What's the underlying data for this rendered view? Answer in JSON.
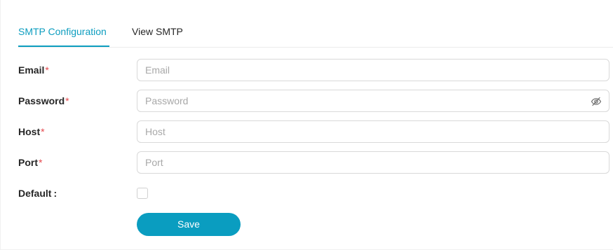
{
  "tabs": {
    "items": [
      {
        "label": "SMTP Configuration",
        "active": true
      },
      {
        "label": "View SMTP",
        "active": false
      }
    ]
  },
  "form": {
    "email": {
      "label": "Email",
      "required_mark": "*",
      "placeholder": "Email",
      "value": ""
    },
    "password": {
      "label": "Password",
      "required_mark": "*",
      "placeholder": "Password",
      "value": "",
      "toggle_icon": "eye-slash-icon"
    },
    "host": {
      "label": "Host",
      "required_mark": "*",
      "placeholder": "Host",
      "value": ""
    },
    "port": {
      "label": "Port",
      "required_mark": "*",
      "placeholder": "Port",
      "value": ""
    },
    "default": {
      "label": "Default",
      "suffix": ":",
      "checked": false
    },
    "save_label": "Save"
  },
  "colors": {
    "accent": "#0d9dbf",
    "button": "#0a9dc0",
    "required": "#e5484d",
    "border": "#d9d9d9"
  }
}
